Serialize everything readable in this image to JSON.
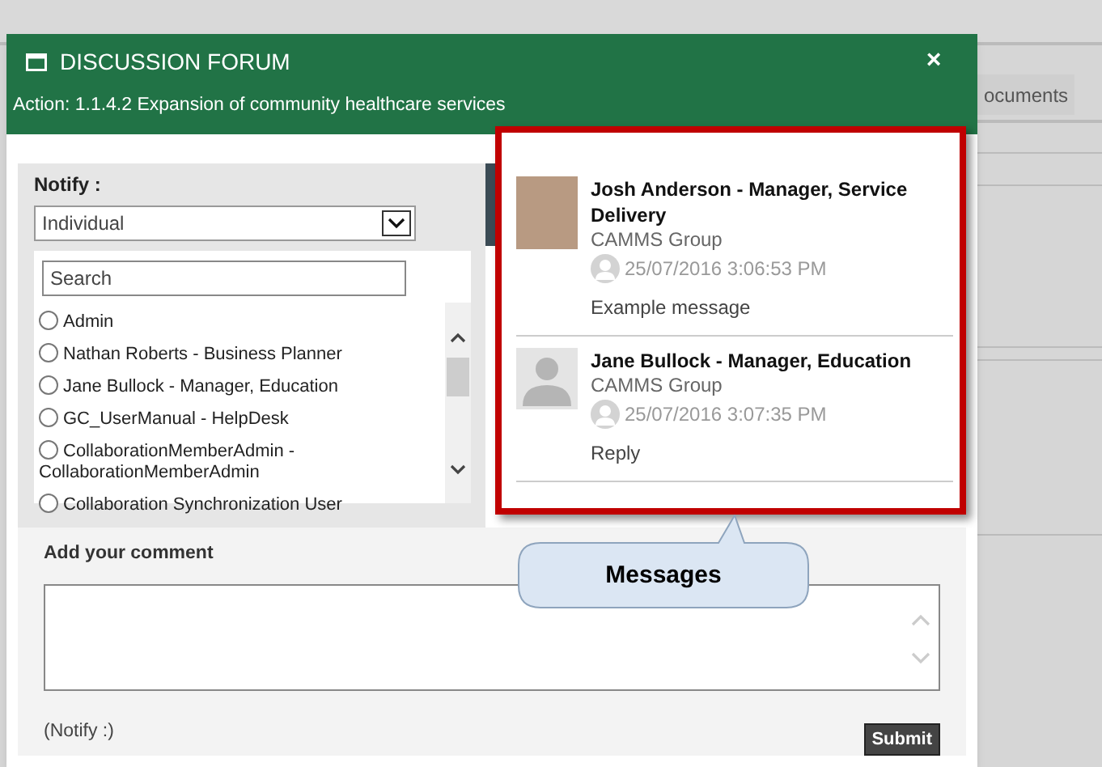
{
  "background_tab": {
    "label": "ocuments"
  },
  "window": {
    "title": "DISCUSSION FORUM",
    "close": "×",
    "subtitle": "Action: 1.1.4.2 Expansion of community healthcare services"
  },
  "notify": {
    "label": "Notify :",
    "dropdown": {
      "value": "Individual"
    },
    "search": {
      "placeholder": "Search"
    },
    "people": [
      {
        "label": "Admin",
        "selected": false
      },
      {
        "label": "Nathan Roberts - Business Planner",
        "selected": false
      },
      {
        "label": "Jane Bullock - Manager, Education",
        "selected": false
      },
      {
        "label": "GC_UserManual - HelpDesk",
        "selected": false
      },
      {
        "label": "CollaborationMemberAdmin - CollaborationMemberAdmin",
        "selected": false
      },
      {
        "label": "Collaboration Synchronization User",
        "selected": false
      }
    ]
  },
  "messages": [
    {
      "author": "Josh Anderson - Manager, Service Delivery",
      "group": "CAMMS Group",
      "time": "25/07/2016 3:06:53 PM",
      "text": "Example message",
      "kind": "photo"
    },
    {
      "author": "Jane Bullock - Manager, Education",
      "group": "CAMMS Group",
      "time": "25/07/2016 3:07:35 PM",
      "text": "Reply",
      "kind": "default"
    }
  ],
  "comment": {
    "label": "Add your comment",
    "notify_note": "(Notify :)",
    "submit": "Submit"
  },
  "callout": {
    "text": "Messages"
  }
}
